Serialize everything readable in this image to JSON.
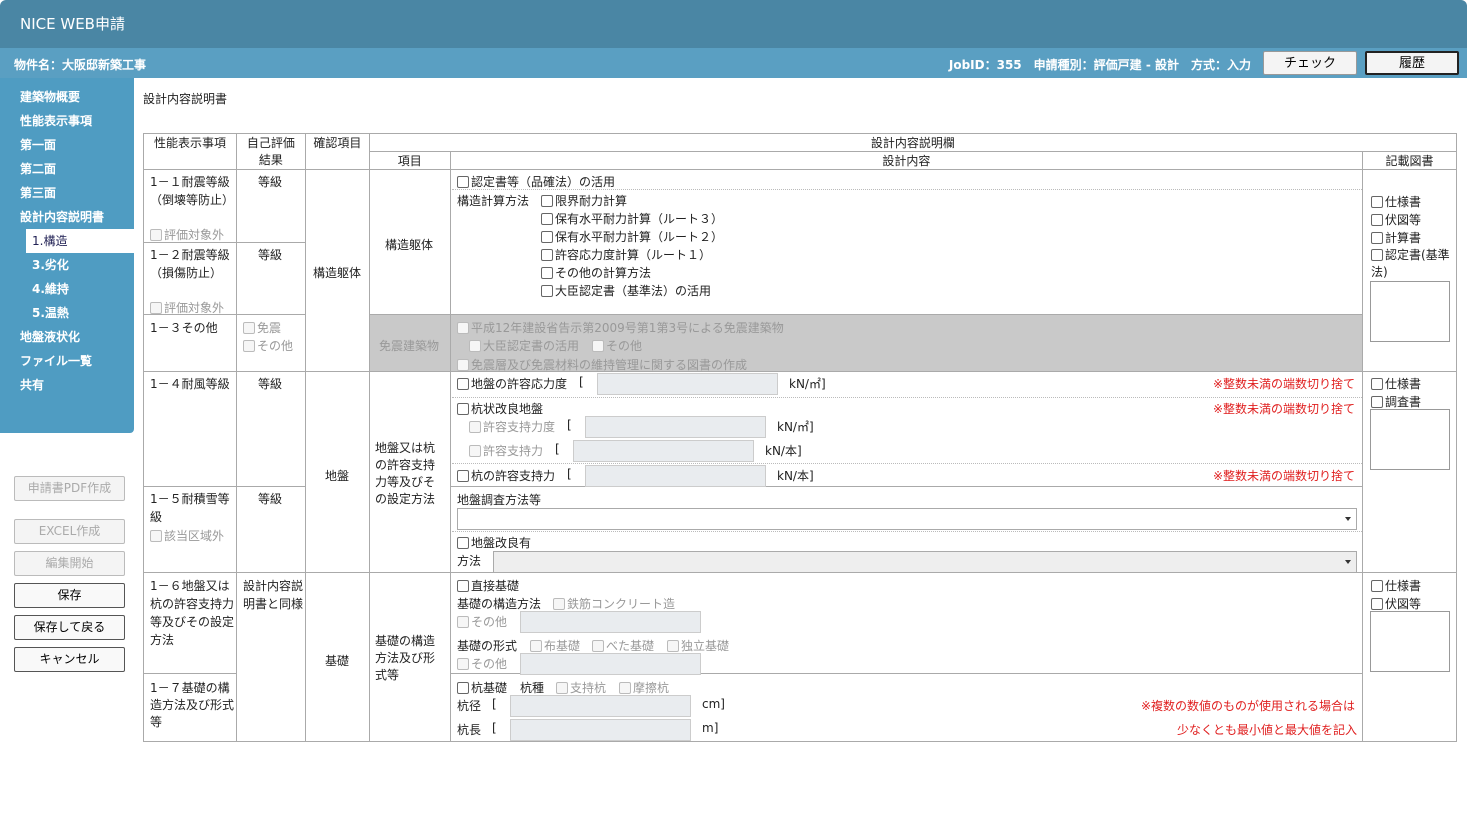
{
  "app": {
    "title": "NICE WEB申請"
  },
  "info": {
    "property": "物件名：大阪邸新築工事",
    "job": "JobID：355　申請種別：評価戸建 - 設計　方式：入力"
  },
  "top_buttons": {
    "check": "チェック",
    "history": "履歴"
  },
  "sidebar": {
    "items": [
      "建築物概要",
      "性能表示事項",
      "第一面",
      "第二面",
      "第三面",
      "設計内容説明書"
    ],
    "sub_active": "1.構造",
    "subs": [
      "3.劣化",
      "4.維持",
      "5.温熱"
    ],
    "more": [
      "地盤液状化",
      "ファイル一覧",
      "共有"
    ]
  },
  "side_buttons": {
    "pdf": "申請書PDF作成",
    "excel": "EXCEL作成",
    "edit": "編集開始",
    "save": "保存",
    "save_back": "保存して戻る",
    "cancel": "キャンセル"
  },
  "page_title": "設計内容説明書",
  "headers": {
    "perf": "性能表示事項",
    "self1": "自己評価",
    "self2": "結果",
    "confirm": "確認項目",
    "design_col": "設計内容説明欄",
    "item": "項目",
    "content": "設計内容",
    "docs": "記載図書"
  },
  "rows": {
    "r11": "1－１耐震等級（倒壊等防止）",
    "r11_ex": "評価対象外",
    "r12": "1－２耐震等級（損傷防止）",
    "r12_ex": "評価対象外",
    "r13": "1－３その他",
    "r13_a": "免震",
    "r13_b": "その他",
    "grade": "等級",
    "struct_confirm": "構造躯体",
    "struct_item": "構造躯体",
    "cert_use": "認定書等（品確法）の活用",
    "calc_label": "構造計算方法",
    "calc": [
      "限界耐力計算",
      "保有水平耐力計算（ルート３）",
      "保有水平耐力計算（ルート２）",
      "許容応力度計算（ルート１）",
      "その他の計算方法",
      "大臣認定書（基準法）の活用"
    ],
    "docs1": [
      "仕様書",
      "伏図等",
      "計算書",
      "認定書(基準法)"
    ],
    "iso_item": "免震建築物",
    "iso1": "平成12年建設省告示第2009号第1第3号による免震建築物",
    "iso2": "大臣認定書の活用",
    "iso3": "その他",
    "iso4": "免震層及び免震材料の維持管理に関する図書の作成",
    "r14": "1－４耐風等級",
    "r15": "1－５耐積雪等級",
    "r15_ex": "該当区域外",
    "ground_confirm": "地盤",
    "ground_item": "地盤又は杭の許容支持力等及びその設定方法",
    "g1": "地盤の許容応力度",
    "bracket": "[",
    "kn_m2": "kN/㎡]",
    "kn_pc": "kN/本]",
    "note_round": "※整数未満の端数切り捨て",
    "g2": "杭状改良地盤",
    "g2a": "許容支持力度",
    "g2b": "許容支持力",
    "g3": "杭の許容支持力",
    "g4": "地盤調査方法等",
    "g5": "地盤改良有",
    "g5m": "方法",
    "docs2": [
      "仕様書",
      "調査書"
    ],
    "r16": "1－６地盤又は杭の許容支持力等及びその設定方法",
    "r16_self": "設計内容説明書と同様",
    "r17": "1－７基礎の構造方法及び形式等",
    "found_confirm": "基礎",
    "found_item": "基礎の構造方法及び形式等",
    "f1": "直接基礎",
    "f2": "基礎の構造方法",
    "f2a": "鉄筋コンクリート造",
    "f_other": "その他",
    "f3": "基礎の形式",
    "f3a": "布基礎",
    "f3b": "べた基礎",
    "f3c": "独立基礎",
    "f4": "杭基礎",
    "f4k": "杭種",
    "f4a": "支持杭",
    "f4b": "摩擦杭",
    "f5": "杭径",
    "cm": "cm]",
    "f6": "杭長",
    "m": "m]",
    "note_multi1": "※複数の数値のものが使用される場合は",
    "note_multi2": "少なくとも最小値と最大値を記入",
    "docs3": [
      "仕様書",
      "伏図等"
    ]
  }
}
